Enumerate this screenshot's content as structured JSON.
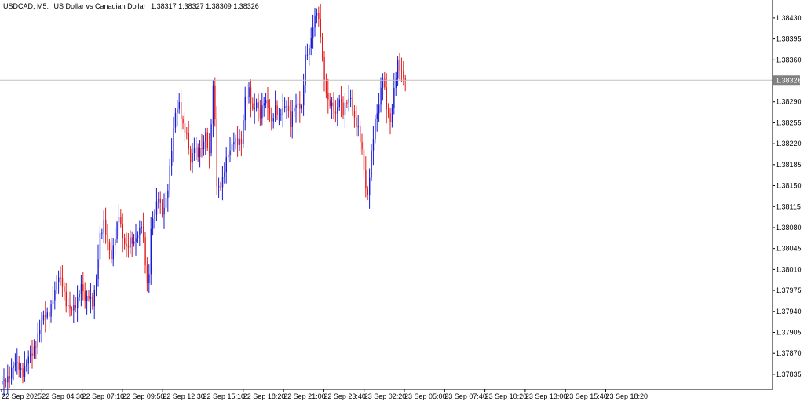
{
  "header": {
    "symbol": "USDCAD, M5:",
    "description": "US Dollar vs Canadian Dollar",
    "quote": "1.38317 1.38327 1.38309 1.38326"
  },
  "colors": {
    "bull": "#1a1ad6",
    "bear": "#e31a1a",
    "axis": "#000000",
    "price_line": "#c0c0c0",
    "price_label_bg": "#808080",
    "price_label_text": "#ffffff"
  },
  "chart_data": {
    "type": "candlestick",
    "symbol": "USDCAD",
    "timeframe": "M5",
    "ylim": [
      1.3781,
      1.3846
    ],
    "y_ticks": [
      "1.38430",
      "1.38395",
      "1.38360",
      "1.38290",
      "1.38255",
      "1.38220",
      "1.38185",
      "1.38150",
      "1.38115",
      "1.38080",
      "1.38045",
      "1.38010",
      "1.37975",
      "1.37940",
      "1.37905",
      "1.37870",
      "1.37835"
    ],
    "x_ticks": [
      "22 Sep 2025",
      "22 Sep 04:30",
      "22 Sep 07:10",
      "22 Sep 09:50",
      "22 Sep 12:30",
      "22 Sep 15:10",
      "22 Sep 18:20",
      "22 Sep 21:00",
      "22 Sep 23:40",
      "23 Sep 02:20",
      "23 Sep 05:00",
      "23 Sep 07:40",
      "23 Sep 10:20",
      "23 Sep 13:00",
      "23 Sep 15:40",
      "23 Sep 18:20"
    ],
    "current_price": "1.38326",
    "price_path": [
      [
        0,
        1.3782
      ],
      [
        1,
        1.3782
      ],
      [
        3,
        1.3783
      ],
      [
        6,
        1.3785
      ],
      [
        8,
        1.3785
      ],
      [
        11,
        1.3784
      ],
      [
        14,
        1.3786
      ],
      [
        16,
        1.3787
      ],
      [
        19,
        1.379
      ],
      [
        22,
        1.3793
      ],
      [
        25,
        1.3794
      ],
      [
        28,
        1.3797
      ],
      [
        30,
        1.38
      ],
      [
        32,
        1.3799
      ],
      [
        34,
        1.3795
      ],
      [
        36,
        1.3794
      ],
      [
        38,
        1.3795
      ],
      [
        40,
        1.3796
      ],
      [
        42,
        1.3798
      ],
      [
        44,
        1.3796
      ],
      [
        46,
        1.3797
      ],
      [
        48,
        1.3795
      ],
      [
        50,
        1.3799
      ],
      [
        52,
        1.3807
      ],
      [
        54,
        1.3809
      ],
      [
        56,
        1.3805
      ],
      [
        58,
        1.3803
      ],
      [
        60,
        1.3807
      ],
      [
        62,
        1.381
      ],
      [
        64,
        1.3806
      ],
      [
        66,
        1.3805
      ],
      [
        68,
        1.3806
      ],
      [
        70,
        1.3805
      ],
      [
        72,
        1.3807
      ],
      [
        74,
        1.3809
      ],
      [
        75,
        1.3806
      ],
      [
        76,
        1.3802
      ],
      [
        77,
        1.3798
      ],
      [
        78,
        1.38
      ],
      [
        79,
        1.3808
      ],
      [
        81,
        1.3811
      ],
      [
        83,
        1.3813
      ],
      [
        85,
        1.381
      ],
      [
        87,
        1.3813
      ],
      [
        88,
        1.3815
      ],
      [
        90,
        1.3821
      ],
      [
        92,
        1.3827
      ],
      [
        94,
        1.3829
      ],
      [
        96,
        1.3825
      ],
      [
        98,
        1.3823
      ],
      [
        100,
        1.3819
      ],
      [
        102,
        1.3822
      ],
      [
        104,
        1.382
      ],
      [
        106,
        1.3821
      ],
      [
        108,
        1.3824
      ],
      [
        110,
        1.382
      ],
      [
        112,
        1.3831
      ],
      [
        113,
        1.3826
      ],
      [
        114,
        1.3815
      ],
      [
        115,
        1.3815
      ],
      [
        117,
        1.3816
      ],
      [
        119,
        1.3819
      ],
      [
        121,
        1.3821
      ],
      [
        123,
        1.3823
      ],
      [
        125,
        1.3822
      ],
      [
        127,
        1.3822
      ],
      [
        129,
        1.383
      ],
      [
        131,
        1.3831
      ],
      [
        133,
        1.3827
      ],
      [
        135,
        1.3829
      ],
      [
        137,
        1.3827
      ],
      [
        139,
        1.3829
      ],
      [
        141,
        1.3828
      ],
      [
        143,
        1.3826
      ],
      [
        145,
        1.3828
      ],
      [
        147,
        1.3826
      ],
      [
        149,
        1.3828
      ],
      [
        151,
        1.3829
      ],
      [
        153,
        1.3825
      ],
      [
        155,
        1.3828
      ],
      [
        157,
        1.3829
      ],
      [
        159,
        1.3828
      ],
      [
        161,
        1.3836
      ],
      [
        163,
        1.3838
      ],
      [
        165,
        1.3842
      ],
      [
        167,
        1.3844
      ],
      [
        169,
        1.384
      ],
      [
        171,
        1.3833
      ],
      [
        173,
        1.3829
      ],
      [
        175,
        1.3828
      ],
      [
        177,
        1.3827
      ],
      [
        179,
        1.383
      ],
      [
        181,
        1.3827
      ],
      [
        183,
        1.3829
      ],
      [
        185,
        1.383
      ],
      [
        187,
        1.3826
      ],
      [
        189,
        1.3824
      ],
      [
        191,
        1.3821
      ],
      [
        193,
        1.3815
      ],
      [
        194,
        1.3813
      ],
      [
        196,
        1.382
      ],
      [
        198,
        1.3826
      ],
      [
        200,
        1.3829
      ],
      [
        202,
        1.3833
      ],
      [
        204,
        1.3828
      ],
      [
        206,
        1.3826
      ],
      [
        208,
        1.3831
      ],
      [
        210,
        1.3835
      ],
      [
        212,
        1.3834
      ],
      [
        214,
        1.3833
      ]
    ]
  }
}
